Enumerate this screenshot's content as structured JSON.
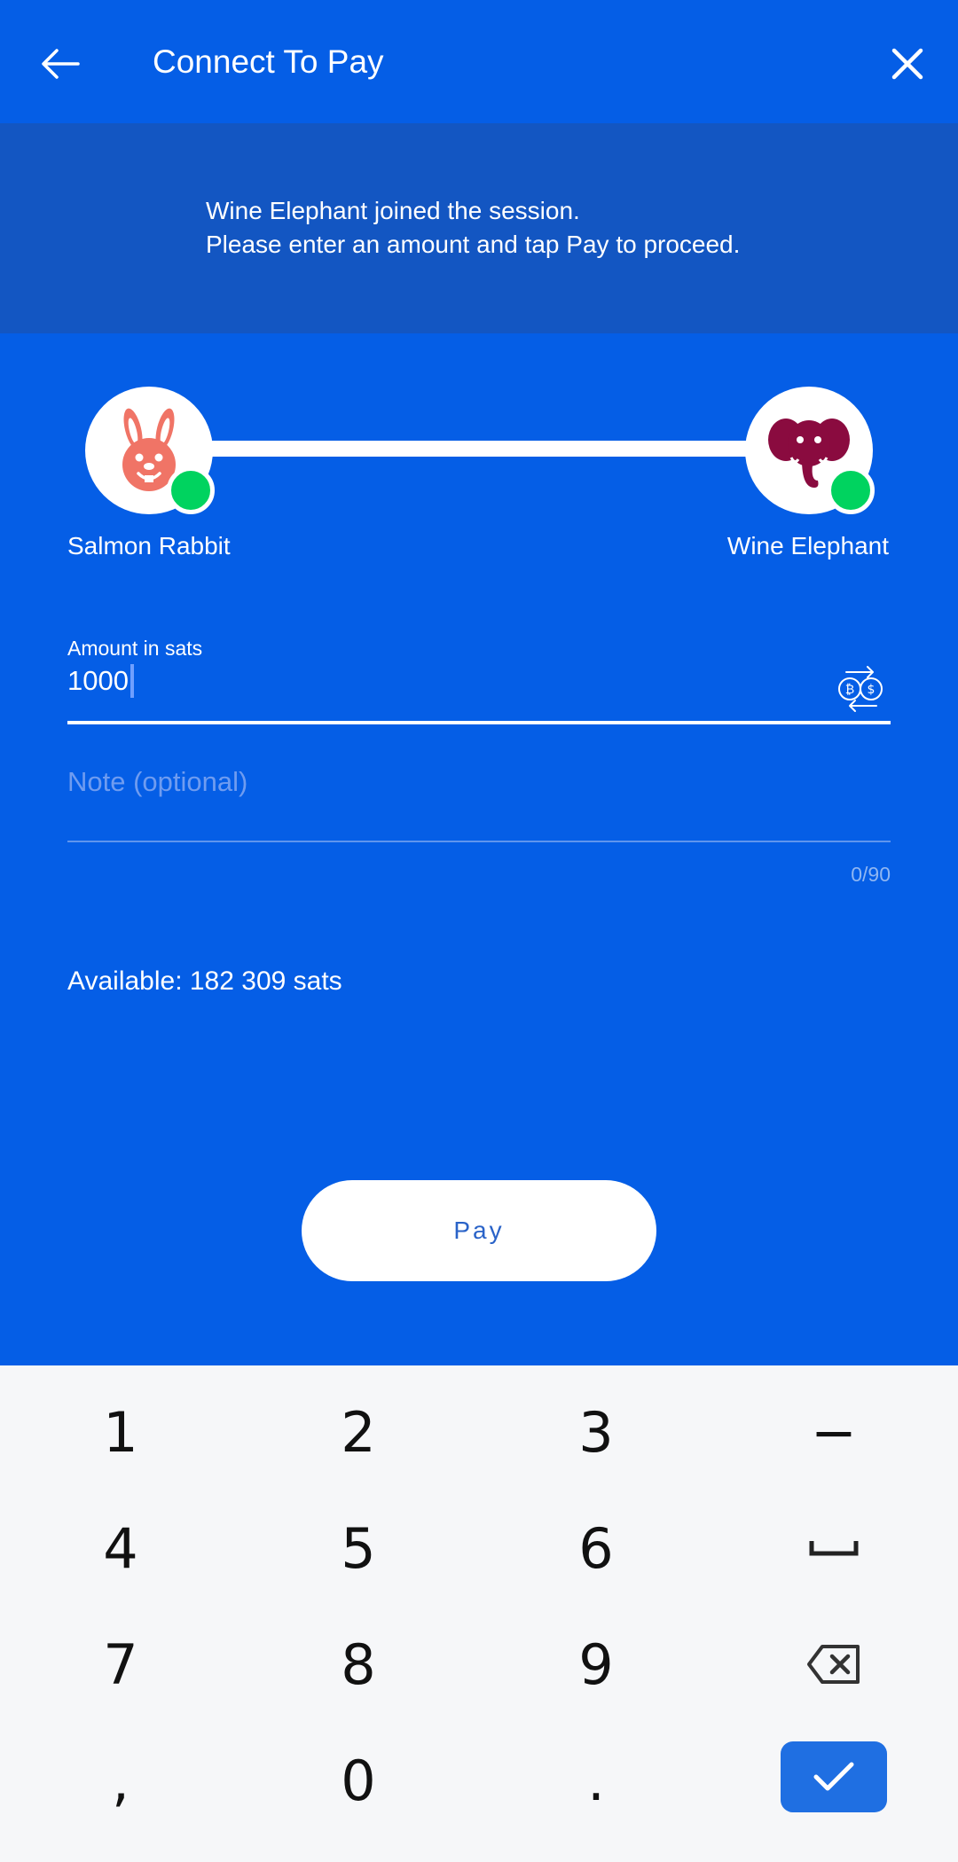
{
  "header": {
    "title": "Connect To Pay",
    "back_icon": "arrow-left-icon",
    "close_icon": "close-icon"
  },
  "banner": {
    "line1": "Wine Elephant joined the session.",
    "line2": "Please enter an amount and tap Pay to proceed."
  },
  "peers": {
    "left": {
      "name": "Salmon Rabbit",
      "icon": "rabbit-avatar-icon",
      "color": "#f07466"
    },
    "right": {
      "name": "Wine Elephant",
      "icon": "elephant-avatar-icon",
      "color": "#8a0b3f"
    },
    "status_color": "#00d35f"
  },
  "form": {
    "amount_label": "Amount in sats",
    "amount_value": "1000",
    "note_placeholder": "Note (optional)",
    "note_counter": "0/90",
    "swap_icon": "currency-swap-icon"
  },
  "available": "Available: 182 309 sats",
  "pay_button": "Pay",
  "keyboard": {
    "keys": [
      "1",
      "2",
      "3",
      "−",
      "4",
      "5",
      "6",
      "space",
      "7",
      "8",
      "9",
      "backspace",
      ",",
      "0",
      ".",
      "enter"
    ]
  },
  "colors": {
    "primary": "#055ee6",
    "banner": "#1356c2",
    "enter_key": "#1f6fe2"
  }
}
